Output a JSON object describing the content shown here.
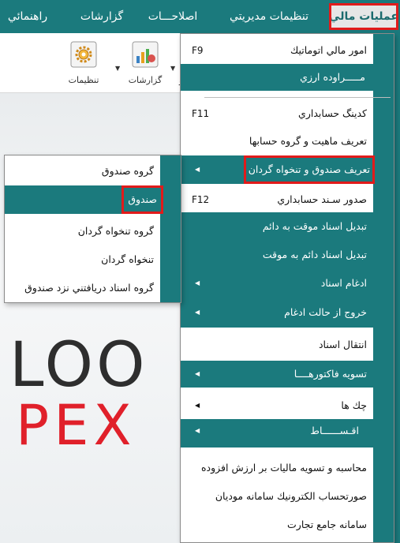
{
  "menubar": {
    "items": [
      {
        "label": "عملیات مالي"
      },
      {
        "label": "تنظيمات مديريتي"
      },
      {
        "label": "اصلاحـــات"
      },
      {
        "label": "گزارشات"
      },
      {
        "label": "راهنمائي"
      }
    ]
  },
  "toolbar": {
    "settings_label": "تنظیمات",
    "reports_label": "گزارشات",
    "cut_text": "سد"
  },
  "logo": {
    "line1": "LOO",
    "line2": "PEX"
  },
  "main_menu": {
    "items": [
      {
        "label": "امور مالي اتوماتيك",
        "shortcut": "F9"
      },
      {
        "label": "مـــــراوده ارزي"
      },
      {
        "label": "كدينگ حسابداري",
        "shortcut": "F11"
      },
      {
        "label": "تعريف ماهيت و گروه حسابها"
      },
      {
        "label": "تعريف صندوق و تنخواه گردان"
      },
      {
        "label": "صدور سـند حسابداري",
        "shortcut": "F12"
      },
      {
        "label": "تبديل اسناد موقت به دائم"
      },
      {
        "label": "تبديل اسناد دائم به موقت"
      },
      {
        "label": "ادغام اسناد"
      },
      {
        "label": "خروج از حالت ادغام"
      },
      {
        "label": "انتقال اسناد"
      },
      {
        "label": "تسويه فاكتورهــــا"
      },
      {
        "label": "چك ها"
      },
      {
        "label": "اقـســــــاط"
      },
      {
        "label": "محاسبه و تسويه ماليات بر ارزش افزوده"
      },
      {
        "label": "صورتحساب الكترونيك سامانه موديان"
      },
      {
        "label": "سامانه جامع تجارت"
      }
    ]
  },
  "sub_menu": {
    "items": [
      {
        "label": "گروه صندوق"
      },
      {
        "label": "صندوق"
      },
      {
        "label": "گروه تنخواه گردان"
      },
      {
        "label": "تنخواه گردان"
      },
      {
        "label": "گروه اسناد دريافتني نزد صندوق"
      }
    ]
  },
  "colors": {
    "accent": "#1b7a7d",
    "highlight": "#e11b1b"
  }
}
